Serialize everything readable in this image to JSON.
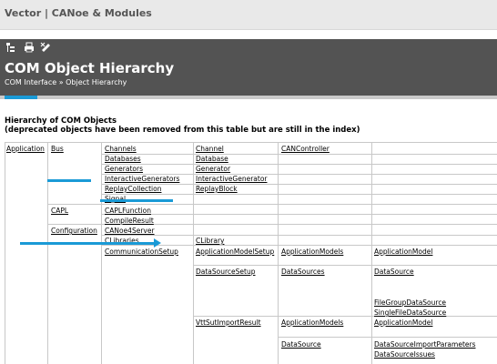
{
  "topbar": {
    "title": "Vector | CANoe & Modules"
  },
  "header": {
    "title": "COM Object Hierarchy",
    "breadcrumb": "COM Interface » Object Hierarchy"
  },
  "section": {
    "heading": "Hierarchy of COM Objects",
    "note": "(deprecated objects have been removed from this table but are still in the index)"
  },
  "colors": {
    "accent": "#1a9ad6",
    "header_bg": "#535353"
  },
  "hierarchy": {
    "application": "Application",
    "bus": "Bus",
    "channels": "Channels",
    "channel": "Channel",
    "can_controller": "CANController",
    "databases": "Databases",
    "database": "Database",
    "generators": "Generators",
    "generator": "Generator",
    "interactive_generators": "InteractiveGenerators",
    "interactive_generator": "InteractiveGenerator",
    "replay_collection": "ReplayCollection",
    "replay_block": "ReplayBlock",
    "signal": "Signal",
    "capl": "CAPL",
    "capl_function": "CAPLFunction",
    "compile_result": "CompileResult",
    "configuration": "Configuration",
    "canoe4server": "CANoe4Server",
    "clibraries": "CLibraries",
    "clibrary": "CLibrary",
    "communication_setup": "CommunicationSetup",
    "application_model_setup": "ApplicationModelSetup",
    "application_models": "ApplicationModels",
    "application_model": "ApplicationModel",
    "data_source_setup": "DataSourceSetup",
    "data_sources": "DataSources",
    "data_source": "DataSource",
    "file_group_data_source": "FileGroupDataSource",
    "single_file_data_source": "SingleFileDataSource",
    "vtt_sut_import_result": "VttSutImportResult",
    "application_models_2": "ApplicationModels",
    "application_model_2": "ApplicationModel",
    "data_source_2": "DataSource",
    "data_source_import_parameters": "DataSourceImportParameters",
    "data_source_issues": "DataSourceIssues"
  }
}
